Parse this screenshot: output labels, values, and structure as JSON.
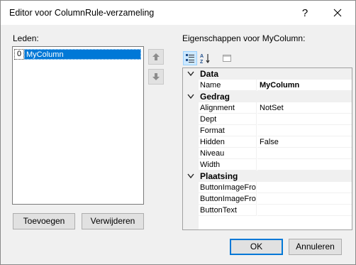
{
  "window": {
    "title": "Editor voor ColumnRule-verzameling",
    "help_label": "?",
    "close_label": "✕"
  },
  "members": {
    "label": "Leden:",
    "items": [
      {
        "index": "0",
        "name": "MyColumn",
        "selected": true
      }
    ]
  },
  "buttons": {
    "add": "Toevoegen",
    "remove": "Verwijderen",
    "ok": "OK",
    "cancel": "Annuleren"
  },
  "properties": {
    "label": "Eigenschappen voor MyColumn:",
    "toolbar": [
      {
        "icon": "categorized-icon",
        "active": true
      },
      {
        "icon": "alphabetical-icon",
        "active": false
      },
      {
        "icon": "property-pages-icon",
        "active": false
      }
    ],
    "categories": [
      {
        "name": "Data",
        "rows": [
          {
            "name": "Name",
            "value": "MyColumn",
            "bold": true
          }
        ]
      },
      {
        "name": "Gedrag",
        "rows": [
          {
            "name": "Alignment",
            "value": "NotSet"
          },
          {
            "name": "Dept",
            "value": ""
          },
          {
            "name": "Format",
            "value": ""
          },
          {
            "name": "Hidden",
            "value": "False"
          },
          {
            "name": "Niveau",
            "value": ""
          },
          {
            "name": "Width",
            "value": ""
          }
        ]
      },
      {
        "name": "Plaatsing",
        "rows": [
          {
            "name": "ButtonImageFron",
            "value": ""
          },
          {
            "name": "ButtonImageFron",
            "value": ""
          },
          {
            "name": "ButtonText",
            "value": ""
          }
        ]
      }
    ]
  },
  "colors": {
    "accent": "#0078d7",
    "selection_text": "#ffffff",
    "window_bg": "#f0f0f0"
  }
}
